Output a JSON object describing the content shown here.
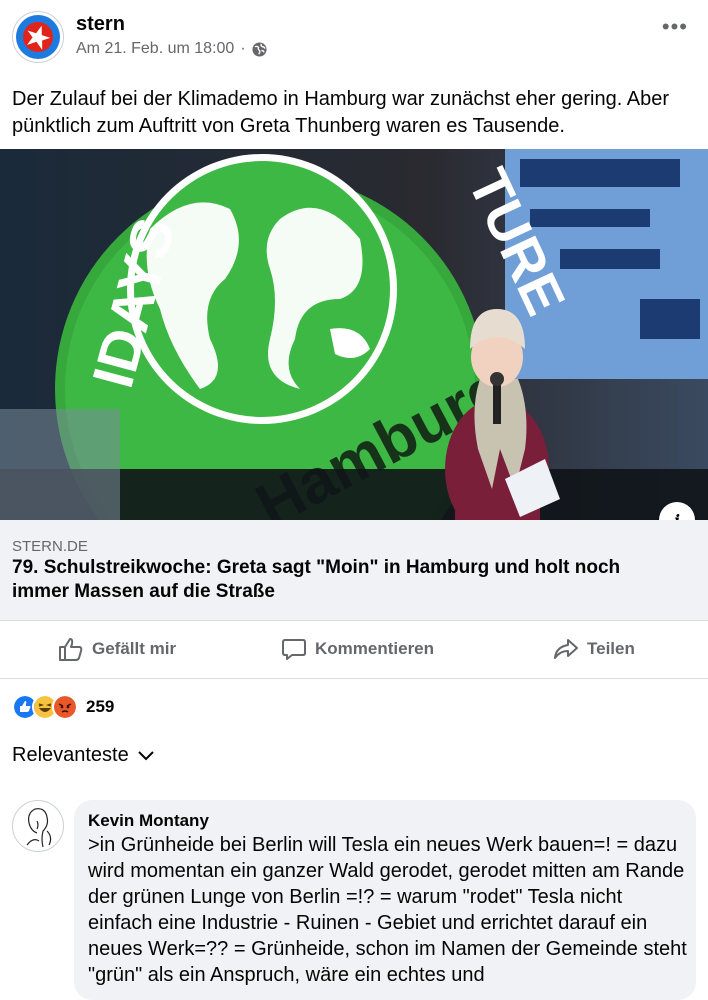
{
  "post": {
    "page_name": "stern",
    "timestamp": "Am 21. Feb. um 18:00",
    "separator": "·",
    "text": "Der Zulauf bei der Klimademo in Hamburg war zunächst eher gering. Aber pünktlich zum Auftritt von Greta Thunberg waren es Tausende."
  },
  "photo": {
    "banner_top": "FRIDAYS FOR FUTURE",
    "banner_city": "Hamburg"
  },
  "link": {
    "domain": "STERN.DE",
    "title": "79. Schulstreikwoche: Greta sagt \"Moin\" in Hamburg und holt noch immer Massen auf die Straße",
    "info_icon": "i"
  },
  "actions": {
    "like": "Gefällt mir",
    "comment": "Kommentieren",
    "share": "Teilen"
  },
  "reactions": {
    "count": "259",
    "types": [
      "like",
      "haha",
      "angry"
    ]
  },
  "comments": {
    "sort_label": "Relevanteste",
    "first": {
      "author": "Kevin Montany",
      "text": ">in Grünheide bei Berlin will Tesla ein neues Werk bauen=! = dazu wird momentan ein ganzer Wald gerodet, gerodet mitten am Rande der grünen Lunge von Berlin =!? = warum \"rodet\" Tesla nicht einfach eine Industrie - Ruinen - Gebiet und errichtet darauf ein neues Werk=?? = Grünheide, schon im Namen der Gemeinde steht \"grün\" als ein Anspruch, wäre ein echtes und"
    }
  },
  "colors": {
    "brand_blue": "#1d7adf",
    "brand_red": "#e2231a",
    "fff_green": "#36a83c",
    "secondary_text": "#65676b",
    "bubble_bg": "#f0f2f5"
  }
}
